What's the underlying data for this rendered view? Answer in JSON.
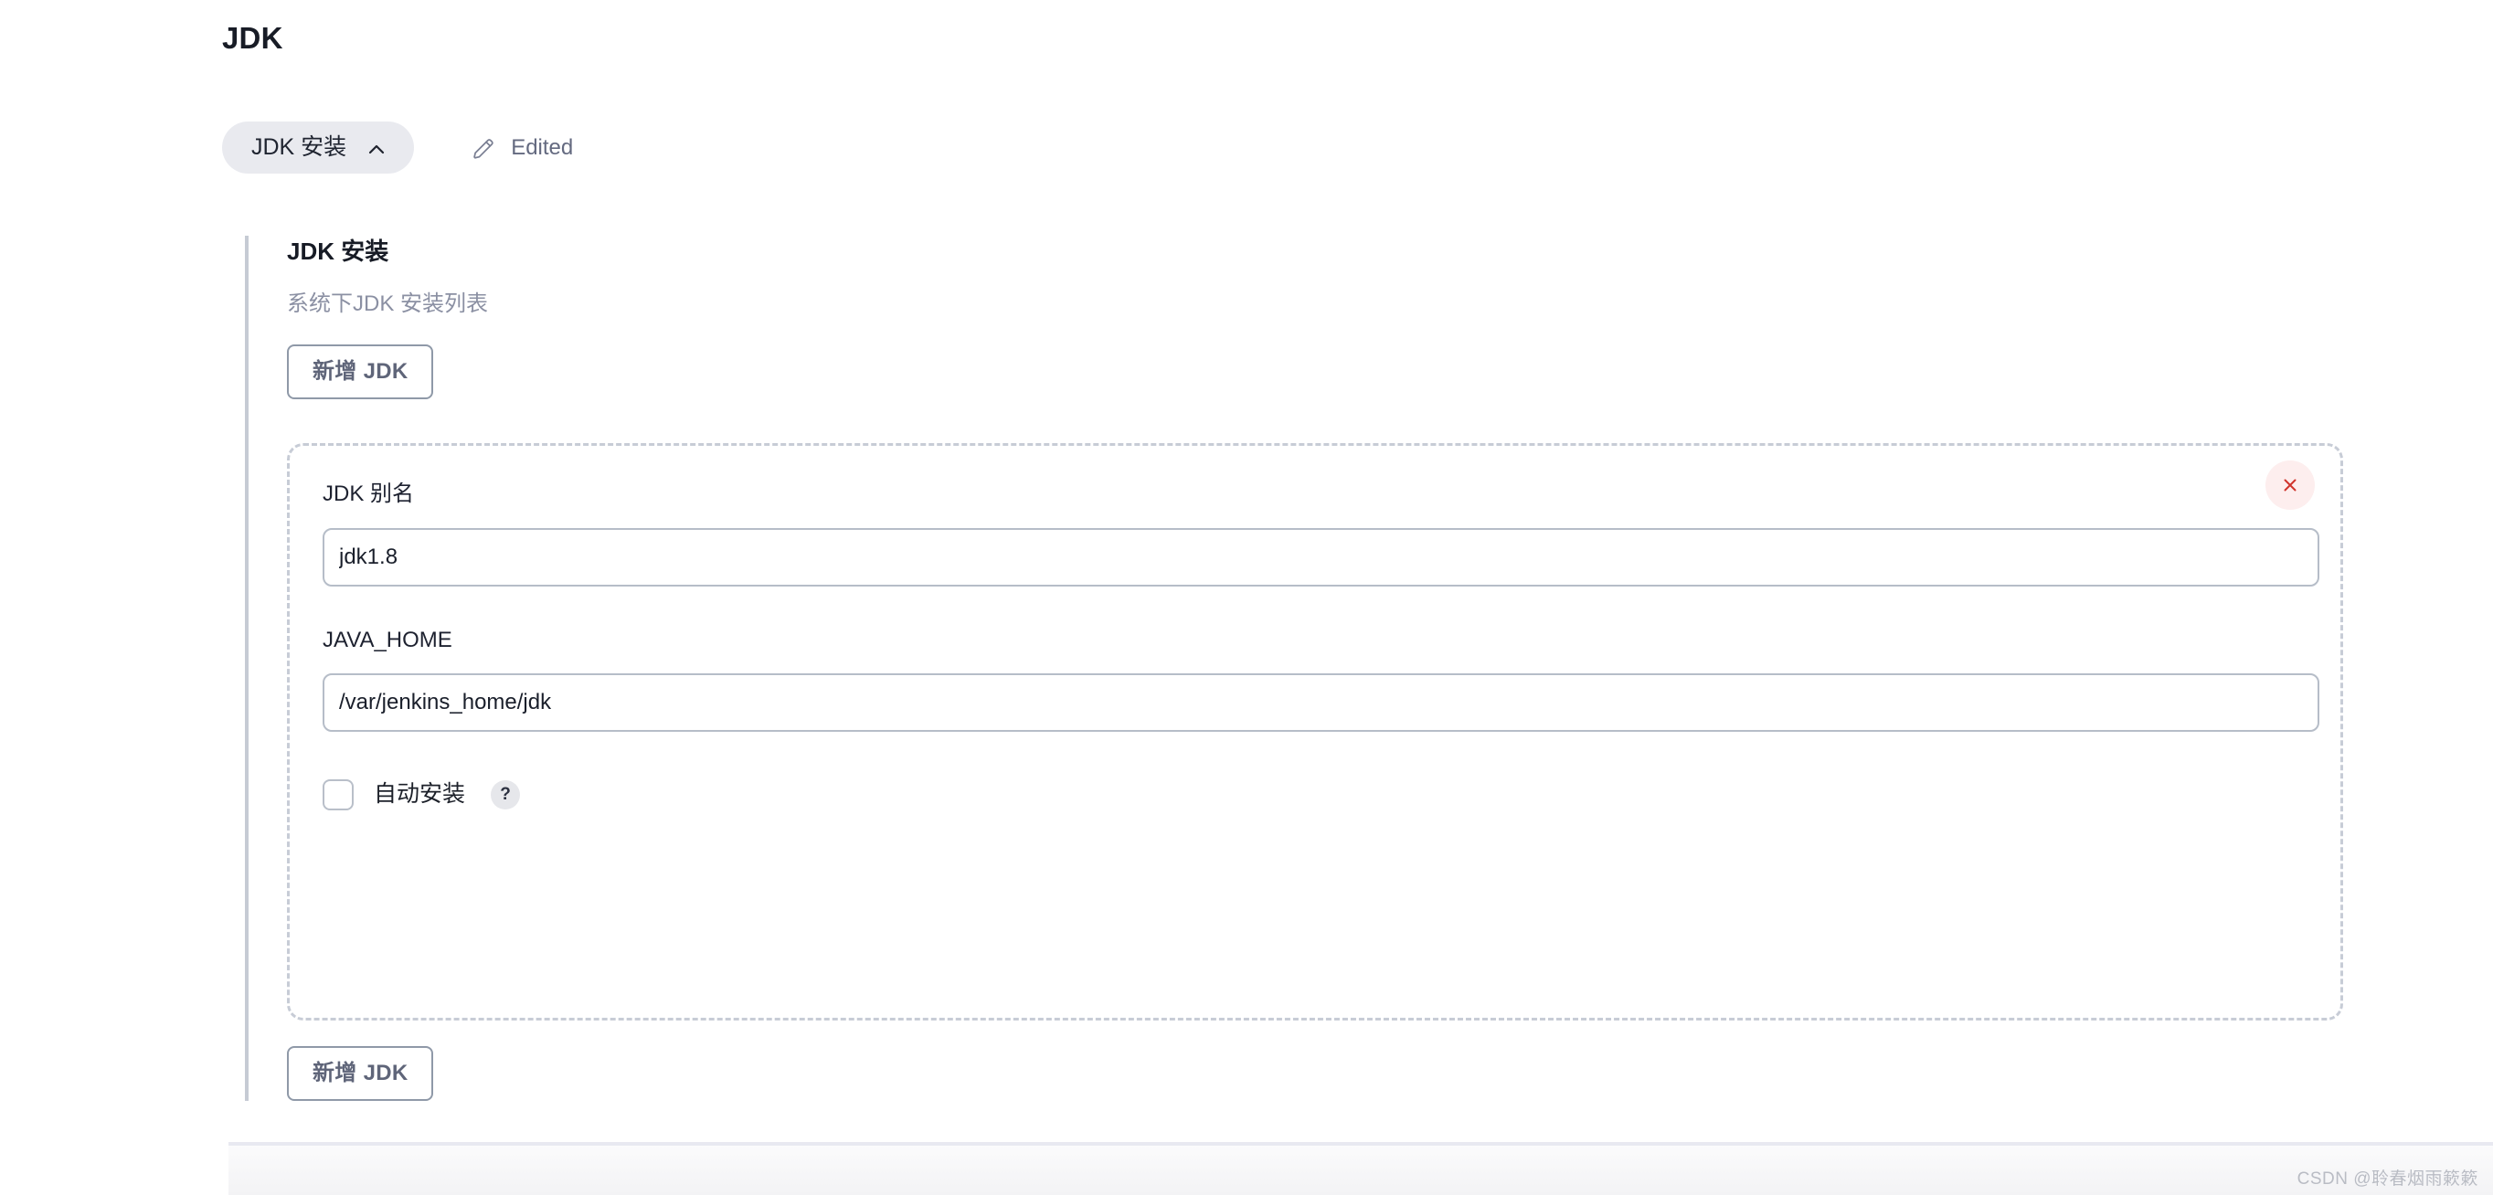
{
  "page": {
    "title": "JDK"
  },
  "toggle": {
    "section_label": "JDK 安装",
    "chevron_icon": "chevron-up-icon",
    "edit_icon": "pencil-icon",
    "edited_label": "Edited"
  },
  "section": {
    "heading": "JDK 安装",
    "description": "系统下JDK 安装列表",
    "add_button_top": "新增 JDK",
    "add_button_bottom": "新增 JDK"
  },
  "entry": {
    "close_icon": "close-icon",
    "fields": [
      {
        "label": "JDK 别名",
        "label_line1": "JDK",
        "label_line2": "别名",
        "value": "jdk1.8",
        "placeholder": ""
      },
      {
        "label": "JAVA_HOME",
        "value": "/var/jenkins_home/jdk",
        "placeholder": ""
      }
    ],
    "checkbox": {
      "label": "自动安装",
      "checked": false,
      "help_icon": "question-mark-icon",
      "help_label": "?"
    }
  },
  "footer": {
    "watermark": "CSDN @聆春烟雨簌簌"
  },
  "colors": {
    "accent_pill_bg": "#e9eaef",
    "rail": "#c6cbd4",
    "dashed_border": "#c7ccd6",
    "input_border": "#b6bdc8",
    "button_border": "#8f99a8",
    "button_text": "#5f6579",
    "muted_text": "#8b90a3",
    "close_bg": "#fdeeee",
    "close_fg": "#d9534f"
  }
}
